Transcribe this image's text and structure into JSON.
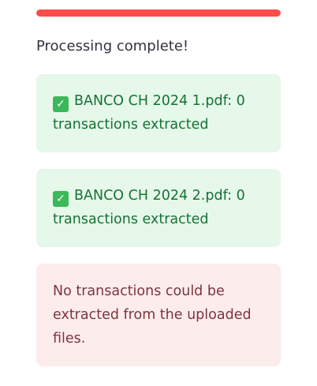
{
  "progress": {
    "value_percent": 100,
    "color": "#ff4b4b"
  },
  "status": {
    "text": "Processing complete!"
  },
  "results": [
    {
      "icon": "checkmark-icon",
      "icon_glyph": "✓",
      "text": "BANCO CH 2024 1.pdf: 0 transactions extracted"
    },
    {
      "icon": "checkmark-icon",
      "icon_glyph": "✓",
      "text": "BANCO CH 2024 2.pdf: 0 transactions extracted"
    }
  ],
  "error": {
    "text": "No transactions could be extracted from the uploaded files."
  },
  "colors": {
    "success_bg": "#e5f8ea",
    "success_text": "#177233",
    "error_bg": "#fdecec",
    "error_text": "#7d353b"
  }
}
